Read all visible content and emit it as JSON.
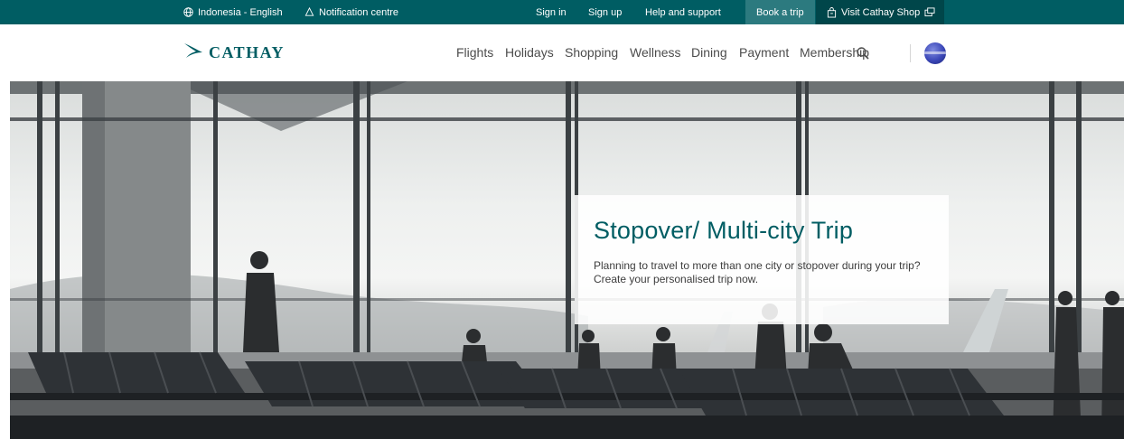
{
  "utility_bar": {
    "language": "Indonesia - English",
    "notifications": "Notification centre",
    "sign_in": "Sign in",
    "sign_up": "Sign up",
    "help": "Help and support",
    "book_trip": "Book a trip",
    "shop": "Visit Cathay Shop"
  },
  "header": {
    "logo_text": "CATHAY",
    "nav": [
      "Flights",
      "Holidays",
      "Shopping",
      "Wellness",
      "Dining",
      "Payment",
      "Membership"
    ]
  },
  "hero": {
    "title": "Stopover/ Multi-city Trip",
    "description": "Planning to travel to more than one city or stopover during your trip? Create your personalised trip now."
  },
  "colors": {
    "brand_teal": "#005d63",
    "book_trip_bg": "#2c7a7f",
    "shop_bg": "#00464a"
  },
  "icons": {
    "language": "globe-icon",
    "notifications": "bell-icon",
    "shop": "shopping-bag-icon",
    "external": "external-link-icon",
    "search": "search-icon"
  }
}
